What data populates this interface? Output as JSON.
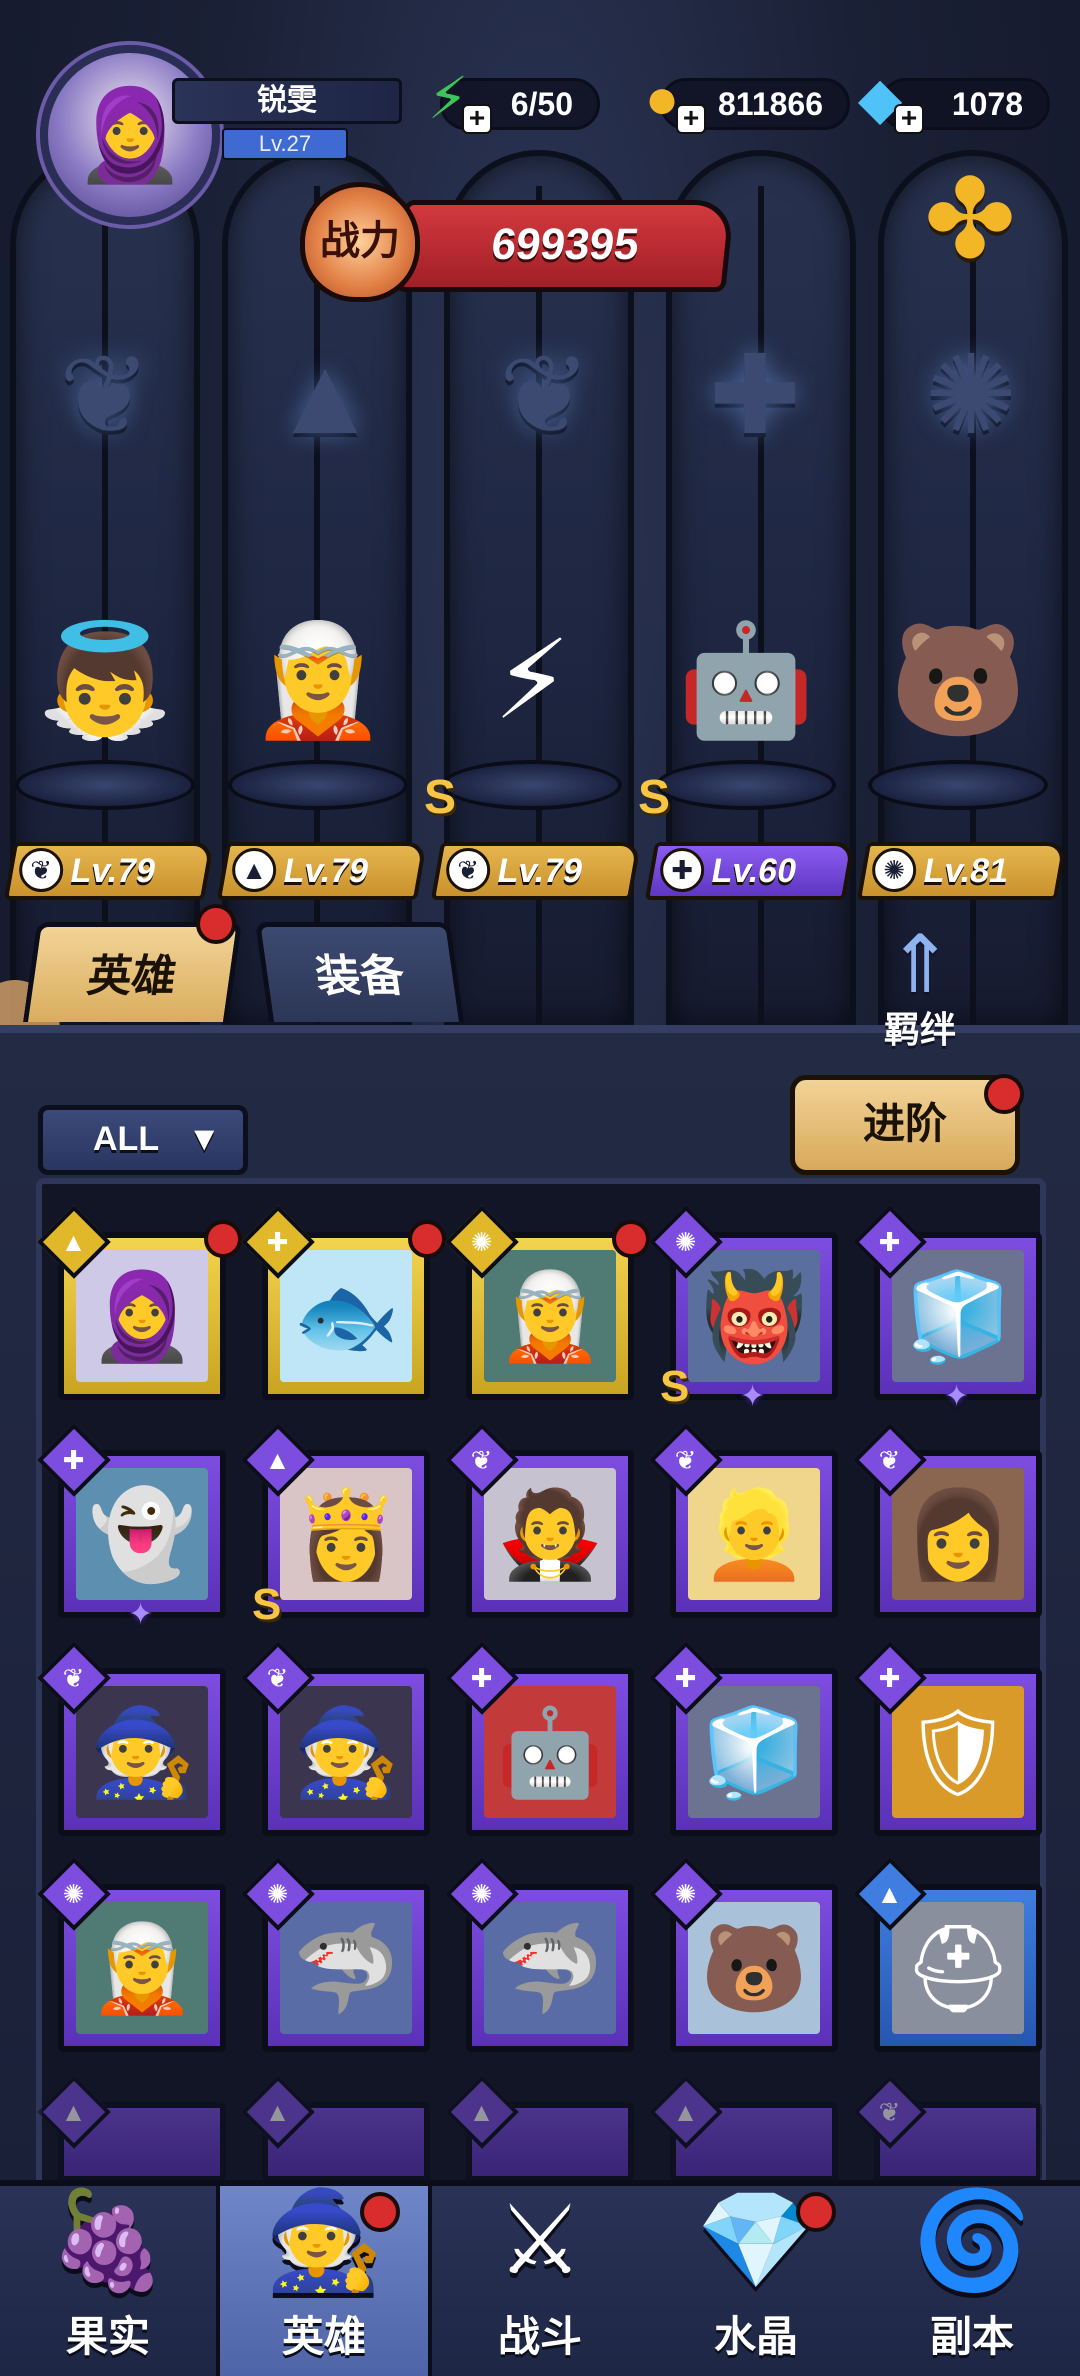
{
  "player": {
    "name": "锐雯",
    "level": "Lv.27",
    "avatar_icon": "nun-avatar-icon"
  },
  "resources": {
    "energy": {
      "value": "6/50",
      "icon": "energy-icon",
      "color": "#3fc45a"
    },
    "gold": {
      "value": "811866",
      "icon": "coin-icon",
      "color": "#f2b626"
    },
    "diamond": {
      "value": "1078",
      "icon": "diamond-icon",
      "color": "#4fc3f7"
    }
  },
  "power": {
    "badge": "战力",
    "value": "699395"
  },
  "lineup": [
    {
      "level": "Lv.79",
      "class_icon": "wing-icon",
      "tag": "gold",
      "s_rank": false,
      "glyph": "👼"
    },
    {
      "level": "Lv.79",
      "class_icon": "mage-hat-icon",
      "tag": "gold",
      "s_rank": false,
      "glyph": "🧝"
    },
    {
      "level": "Lv.79",
      "class_icon": "wing-icon",
      "tag": "gold",
      "s_rank": true,
      "glyph": "⚡"
    },
    {
      "level": "Lv.60",
      "class_icon": "wrench-icon",
      "tag": "purple",
      "s_rank": true,
      "glyph": "🤖"
    },
    {
      "level": "Lv.81",
      "class_icon": "beast-icon",
      "tag": "gold",
      "s_rank": false,
      "glyph": "🐻"
    }
  ],
  "tabs": {
    "heroes": "英雄",
    "equipment": "装备"
  },
  "bond": {
    "label": "羁绊"
  },
  "filter": {
    "label": "ALL"
  },
  "advance": {
    "label": "进阶"
  },
  "s_rank_text": "S",
  "hero_cards": [
    {
      "rarity": "gold",
      "class_icon": "mage-hat-icon",
      "red_dot": true,
      "s_rank": false,
      "star": false,
      "glyph": "🧕",
      "bg": "#cfc9e8"
    },
    {
      "rarity": "gold",
      "class_icon": "wrench-icon",
      "red_dot": true,
      "s_rank": false,
      "star": false,
      "glyph": "🐟",
      "bg": "#bfe6f7"
    },
    {
      "rarity": "gold",
      "class_icon": "beast-icon",
      "red_dot": true,
      "s_rank": false,
      "star": false,
      "glyph": "🧝",
      "bg": "#4f7b74"
    },
    {
      "rarity": "purple",
      "class_icon": "beast-icon",
      "red_dot": false,
      "s_rank": true,
      "star": true,
      "glyph": "👹",
      "bg": "#5a6f9e"
    },
    {
      "rarity": "purple",
      "class_icon": "wrench-icon",
      "red_dot": false,
      "s_rank": false,
      "star": true,
      "glyph": "🧊",
      "bg": "#6c7390"
    },
    {
      "rarity": "purple",
      "class_icon": "wrench-icon",
      "red_dot": false,
      "s_rank": false,
      "star": true,
      "glyph": "👻",
      "bg": "#5d8fb0"
    },
    {
      "rarity": "purple",
      "class_icon": "mage-hat-icon",
      "red_dot": false,
      "s_rank": true,
      "star": false,
      "glyph": "👸",
      "bg": "#d9c5c5"
    },
    {
      "rarity": "purple",
      "class_icon": "wing-icon",
      "red_dot": false,
      "s_rank": false,
      "star": false,
      "glyph": "🧛",
      "bg": "#c7c2cf"
    },
    {
      "rarity": "purple",
      "class_icon": "wing-icon",
      "red_dot": false,
      "s_rank": false,
      "star": false,
      "glyph": "👱",
      "bg": "#f0d68c"
    },
    {
      "rarity": "purple",
      "class_icon": "wing-icon",
      "red_dot": false,
      "s_rank": false,
      "star": false,
      "glyph": "👩",
      "bg": "#8a6550"
    },
    {
      "rarity": "purple",
      "class_icon": "wing-icon",
      "red_dot": false,
      "s_rank": false,
      "star": false,
      "glyph": "🧙",
      "bg": "#3c3550"
    },
    {
      "rarity": "purple",
      "class_icon": "wing-icon",
      "red_dot": false,
      "s_rank": false,
      "star": false,
      "glyph": "🧙",
      "bg": "#3c3550"
    },
    {
      "rarity": "purple",
      "class_icon": "wrench-icon",
      "red_dot": false,
      "s_rank": false,
      "star": false,
      "glyph": "🤖",
      "bg": "#c23a3a"
    },
    {
      "rarity": "purple",
      "class_icon": "wrench-icon",
      "red_dot": false,
      "s_rank": false,
      "star": false,
      "glyph": "🧊",
      "bg": "#6c7390"
    },
    {
      "rarity": "purple",
      "class_icon": "wrench-icon",
      "red_dot": false,
      "s_rank": false,
      "star": false,
      "glyph": "🛡",
      "bg": "#d99a2a"
    },
    {
      "rarity": "purple",
      "class_icon": "beast-icon",
      "red_dot": false,
      "s_rank": false,
      "star": false,
      "glyph": "🧝",
      "bg": "#4f7b74"
    },
    {
      "rarity": "purple",
      "class_icon": "beast-icon",
      "red_dot": false,
      "s_rank": false,
      "star": false,
      "glyph": "🦈",
      "bg": "#5a6ca6"
    },
    {
      "rarity": "purple",
      "class_icon": "beast-icon",
      "red_dot": false,
      "s_rank": false,
      "star": false,
      "glyph": "🦈",
      "bg": "#5a6ca6"
    },
    {
      "rarity": "purple",
      "class_icon": "beast-icon",
      "red_dot": false,
      "s_rank": false,
      "star": false,
      "glyph": "🐻",
      "bg": "#a9c1d9"
    },
    {
      "rarity": "blue",
      "class_icon": "mage-hat-icon",
      "red_dot": false,
      "s_rank": false,
      "star": false,
      "glyph": "⛑",
      "bg": "#8a8f9e"
    }
  ],
  "nav": [
    {
      "label": "果实",
      "icon": "fruit-icon",
      "glyph": "🍇",
      "active": false,
      "red_dot": false
    },
    {
      "label": "英雄",
      "icon": "hero-hat-icon",
      "glyph": "🧙",
      "active": true,
      "red_dot": true
    },
    {
      "label": "战斗",
      "icon": "battle-sword-icon",
      "glyph": "⚔",
      "active": false,
      "red_dot": false
    },
    {
      "label": "水晶",
      "icon": "crystal-icon",
      "glyph": "💎",
      "active": false,
      "red_dot": true
    },
    {
      "label": "副本",
      "icon": "dungeon-portal-icon",
      "glyph": "🌀",
      "active": false,
      "red_dot": false
    }
  ],
  "colors": {
    "accent_gold": "#e6b54e",
    "accent_purple": "#7d4de0",
    "red_dot": "#d92c2c"
  }
}
